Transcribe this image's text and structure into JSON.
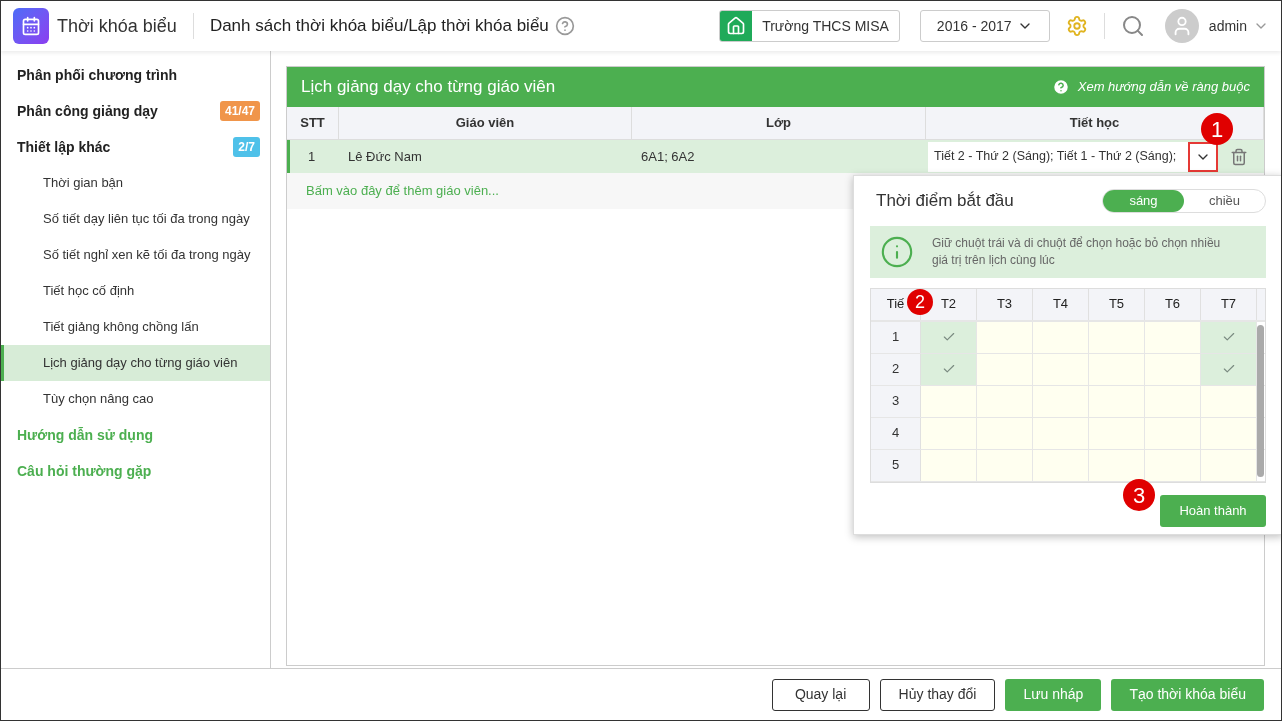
{
  "header": {
    "app_title": "Thời khóa biểu",
    "page_title": "Danh sách thời khóa biểu/Lập thời khóa biểu",
    "school": "Trường THCS MISA",
    "year": "2016 - 2017",
    "user": "admin"
  },
  "sidebar": {
    "items": [
      {
        "kind": "section",
        "label": "Phân phối chương trình",
        "selected": false
      },
      {
        "kind": "section",
        "label": "Phân công giảng dạy",
        "badge": "41/47",
        "color": "#f0954a",
        "selected": false
      },
      {
        "kind": "section",
        "label": "Thiết lập khác",
        "badge": "2/7",
        "color": "#4fc1e9",
        "selected": false
      },
      {
        "kind": "item",
        "label": "Thời gian bận",
        "selected": false
      },
      {
        "kind": "item",
        "label": "Số tiết dạy liên tục tối đa trong ngày",
        "selected": false
      },
      {
        "kind": "item",
        "label": "Số tiết nghỉ xen kẽ tối đa trong ngày",
        "selected": false
      },
      {
        "kind": "item",
        "label": "Tiết học cố định",
        "selected": false
      },
      {
        "kind": "item",
        "label": "Tiết giảng không chồng lấn",
        "selected": false
      },
      {
        "kind": "item",
        "label": "Lịch giảng dạy cho từng giáo viên",
        "selected": true
      },
      {
        "kind": "item",
        "label": "Tùy chọn nâng cao",
        "selected": false
      },
      {
        "kind": "link",
        "label": "Hướng dẫn sử dụng",
        "selected": false
      },
      {
        "kind": "link",
        "label": "Câu hỏi thường gặp",
        "selected": false
      }
    ]
  },
  "panel": {
    "title": "Lịch giảng dạy cho từng giáo viên",
    "help_link": "Xem hướng dẫn về ràng buộc",
    "table": {
      "columns": [
        "STT",
        "Giáo viên",
        "Lớp",
        "Tiết học"
      ],
      "rows": [
        {
          "stt": "1",
          "teacher": "Lê Đức Nam",
          "class": "6A1; 6A2",
          "periods": "Tiết 2 - Thứ 2 (Sáng); Tiết 1 - Thứ 2 (Sáng);",
          "selected": true
        }
      ],
      "add_hint": "Bấm vào đây để thêm giáo viên..."
    }
  },
  "popup": {
    "title": "Thời điểm bắt đầu",
    "toggle": [
      {
        "label": "sáng",
        "selected": true
      },
      {
        "label": "chiều",
        "selected": false
      }
    ],
    "info": "Giữ chuột trái và di chuột để chọn hoặc bỏ chọn nhiều giá trị trên lịch cùng lúc",
    "grid": {
      "columns": [
        "Tiế",
        "T2",
        "T3",
        "T4",
        "T5",
        "T6",
        "T7"
      ],
      "rows": [
        {
          "label": "1",
          "cells": [
            true,
            false,
            false,
            false,
            false,
            true
          ]
        },
        {
          "label": "2",
          "cells": [
            true,
            false,
            false,
            false,
            false,
            true
          ]
        },
        {
          "label": "3",
          "cells": [
            false,
            false,
            false,
            false,
            false,
            false
          ]
        },
        {
          "label": "4",
          "cells": [
            false,
            false,
            false,
            false,
            false,
            false
          ]
        },
        {
          "label": "5",
          "cells": [
            false,
            false,
            false,
            false,
            false,
            false
          ]
        }
      ]
    },
    "done_button": "Hoàn thành"
  },
  "annotations": [
    "1",
    "2",
    "3"
  ],
  "footer": {
    "buttons": [
      {
        "label": "Quay lại",
        "kind": "outline"
      },
      {
        "label": "Hủy thay đổi",
        "kind": "outline"
      },
      {
        "label": "Lưu nháp",
        "kind": "primary"
      },
      {
        "label": "Tạo thời khóa biểu",
        "kind": "primary"
      }
    ]
  }
}
